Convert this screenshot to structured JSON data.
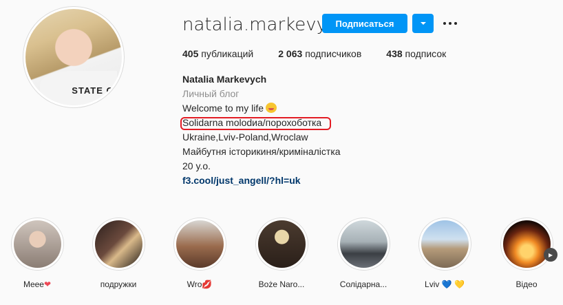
{
  "profile": {
    "username": "natalia.markevych",
    "follow_label": "Подписаться",
    "stats": {
      "posts_count": "405",
      "posts_label": "публикаций",
      "followers_count": "2 063",
      "followers_label": "подписчиков",
      "following_count": "438",
      "following_label": "подписок"
    },
    "avatar_shirt_text": "STATE OF",
    "bio": {
      "name": "Natalia Markevych",
      "category": "Личный блог",
      "line1": "Welcome to my life",
      "line2": "Solidarna molodиа/порохоботка",
      "line3": "Ukraine,Lviv-Poland,Wroclaw",
      "line4": "Майбутня історикиня/криміналістка",
      "line5": "20 y.o.",
      "link": "f3.cool/just_angell/?hl=uk"
    }
  },
  "highlights": [
    {
      "label": "Meee",
      "suffix": "❤",
      "suffix_color": "#ed4956"
    },
    {
      "label": "подружки",
      "suffix": ""
    },
    {
      "label": "Wro",
      "suffix": "💋",
      "suffix_color": "#ed4956"
    },
    {
      "label": "Boże Naro...",
      "suffix": ""
    },
    {
      "label": "Солідарна...",
      "suffix": ""
    },
    {
      "label": "Lviv",
      "suffix": "💙 💛"
    },
    {
      "label": "Відео",
      "suffix": ""
    }
  ],
  "icons": {
    "more_options": "more-horizontal-icon",
    "dropdown": "chevron-down-icon",
    "next": "chevron-right-icon"
  }
}
